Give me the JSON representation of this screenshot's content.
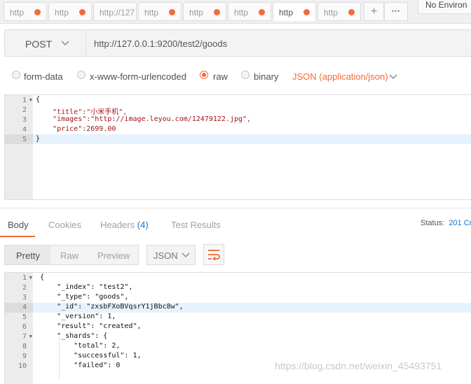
{
  "tabs": [
    {
      "label": "http",
      "dirty": true,
      "active": false
    },
    {
      "label": "http",
      "dirty": true,
      "active": false
    },
    {
      "label": "http://127",
      "dirty": false,
      "active": false
    },
    {
      "label": "http",
      "dirty": true,
      "active": false
    },
    {
      "label": "http",
      "dirty": true,
      "active": false
    },
    {
      "label": "http",
      "dirty": true,
      "active": false
    },
    {
      "label": "http",
      "dirty": true,
      "active": true
    },
    {
      "label": "http",
      "dirty": true,
      "active": false
    }
  ],
  "tab_actions": {
    "add": "+",
    "more": "•••"
  },
  "environment": {
    "label": "No Environ"
  },
  "request": {
    "method": "POST",
    "url": "http://127.0.0.1:9200/test2/goods"
  },
  "body_types": {
    "form_data": "form-data",
    "urlencoded": "x-www-form-urlencoded",
    "raw": "raw",
    "binary": "binary",
    "selected": "raw",
    "content_type": "JSON (application/json)"
  },
  "request_body": {
    "line_numbers": [
      "1",
      "2",
      "3",
      "4",
      "5"
    ],
    "lines": [
      "{",
      "    \"title\":\"小米手机\",",
      "    \"images\":\"http://image.leyou.com/12479122.jpg\",",
      "    \"price\":2699.00",
      "}"
    ]
  },
  "response_tabs": {
    "body": "Body",
    "cookies": "Cookies",
    "headers": "Headers",
    "headers_count": "(4)",
    "test_results": "Test Results"
  },
  "status": {
    "label": "Status:",
    "value": "201 Cr"
  },
  "view_modes": {
    "pretty": "Pretty",
    "raw": "Raw",
    "preview": "Preview",
    "format": "JSON"
  },
  "response_body": {
    "line_numbers": [
      "1",
      "2",
      "3",
      "4",
      "5",
      "6",
      "7",
      "8",
      "9",
      "10"
    ],
    "lines": [
      "{",
      "    \"_index\": \"test2\",",
      "    \"_type\": \"goods\",",
      "    \"_id\": \"zxsbFXoBVqsrY1jBbc8w\",",
      "    \"_version\": 1,",
      "    \"result\": \"created\",",
      "    \"_shards\": {",
      "        \"total\": 2,",
      "        \"successful\": 1,",
      "        \"failed\": 0"
    ]
  },
  "watermark": "https://blog.csdn.net/weixin_45493751",
  "colors": {
    "accent": "#f26b3a",
    "link_blue": "#1a73c7",
    "selection": "#b6d7ff"
  }
}
